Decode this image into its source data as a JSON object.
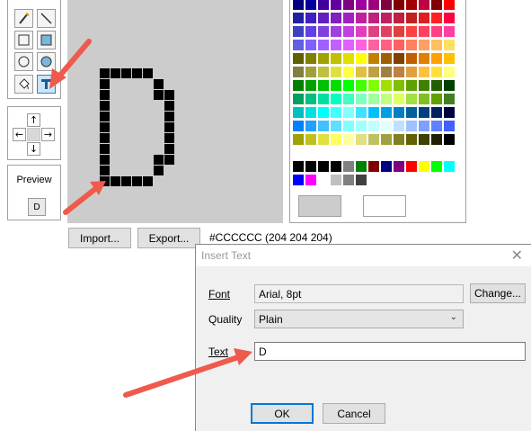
{
  "preview": {
    "title": "Preview",
    "char": "D"
  },
  "color_readout": "#CCCCCC (204 204 204)",
  "buttons": {
    "import": "Import...",
    "export": "Export..."
  },
  "dialog": {
    "title": "Insert Text",
    "close": "✕",
    "font_label": "Font",
    "font_value": "Arial, 8pt",
    "change_button": "Change...",
    "quality_label": "Quality",
    "quality_value": "Plain",
    "text_label": "Text",
    "text_value": "D",
    "ok": "OK",
    "cancel": "Cancel"
  },
  "tools": [
    "pencil-icon",
    "line-icon",
    "rectangle-icon",
    "filled-rectangle-icon",
    "ellipse-icon",
    "filled-ellipse-icon",
    "fill-bucket-icon",
    "text-tool-icon"
  ],
  "nudge": [
    "arrow-up-icon",
    "arrow-left-icon",
    "arrow-right-icon",
    "arrow-down-icon"
  ],
  "colors": {
    "grid_background": "#cccccc",
    "pixel_on": "#000000",
    "selected_primary": "#cccccc",
    "selected_secondary": "#ffffff",
    "arrow": "#ee5a4c",
    "accent": "#0078d7"
  },
  "pixel_glyph": {
    "rows": [
      "..........................",
      "...........................",
      ".....................",
      ".....................",
      ".....................",
      ".....................",
      ".....................",
      "...#####.............",
      "...#...##............",
      "...#....##...........",
      "...#.....#...........",
      "...#.....#...........",
      "...#.....#...........",
      "...#.....#...........",
      "...#.....#...........",
      "...#....##...........",
      "...#...##............",
      "...#####.............",
      ".....................",
      ".....................",
      "....................."
    ]
  }
}
